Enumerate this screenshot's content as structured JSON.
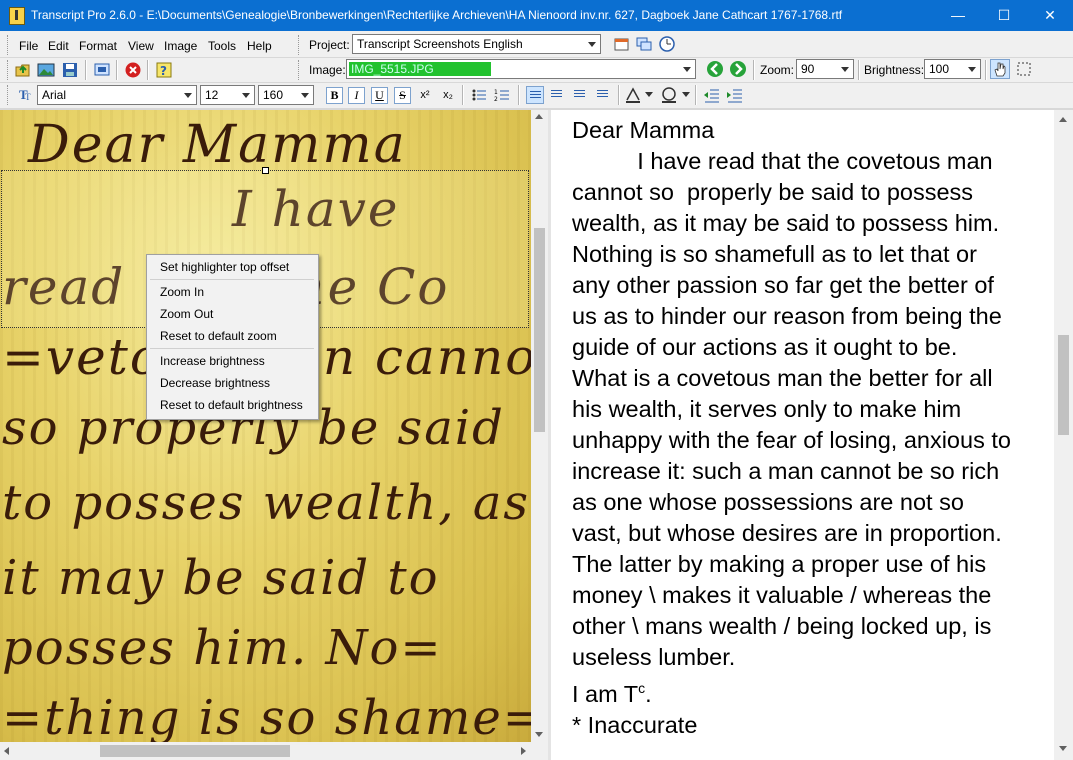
{
  "window": {
    "title": "Transcript Pro 2.6.0 - E:\\Documents\\Genealogie\\Bronbewerkingen\\Rechterlijke Archieven\\HA Nienoord inv.nr. 627, Dagboek Jane Cathcart 1767-1768.rtf",
    "minimize": "—",
    "maximize": "☐",
    "close": "✕"
  },
  "menu": [
    "File",
    "Edit",
    "Format",
    "View",
    "Image",
    "Tools",
    "Help"
  ],
  "project": {
    "label": "Project:",
    "value": "Transcript Screenshots English"
  },
  "image": {
    "label": "Image:",
    "value": "IMG_5515.JPG",
    "progress": 0.5
  },
  "zoom": {
    "label": "Zoom:",
    "value": "90"
  },
  "brightness": {
    "label": "Brightness:",
    "value": "100"
  },
  "font": {
    "name": "Arial",
    "size": "12",
    "second": "160"
  },
  "format_buttons": {
    "bold": "B",
    "italic": "I",
    "underline": "U",
    "strike": "S",
    "superscript": "x²",
    "subscript": "x₂"
  },
  "handwriting": [
    "Dear Mamma",
    "I have",
    "read that the Co",
    "=vetous man cannot",
    "so properly be said",
    "to posses wealth, as",
    "it may be said to",
    "posses him. No=",
    "=thing is so shame="
  ],
  "context_menu": [
    "Set highlighter top offset",
    "Zoom In",
    "Zoom Out",
    "Reset to default zoom",
    "Increase brightness",
    "Decrease brightness",
    "Reset to default brightness"
  ],
  "transcript": [
    "Dear Mamma",
    "          I have read that the covetous man",
    "cannot so  properly be said to possess",
    "wealth, as it may be said to possess him.",
    "Nothing is so shamefull as to let that or",
    "any other passion so far get the better of",
    "us as to hinder our reason from being the",
    "guide of our actions as it ought to be.",
    "What is a covetous man the better for all",
    "his wealth, it serves only to make him",
    "unhappy with the fear of losing, anxious to",
    "increase it: such a man cannot be so rich",
    "as one whose possessions are not so",
    "vast, but whose desires are in proportion.",
    "The latter by making a proper use of his",
    "money \\ makes it valuable / whereas the",
    "other \\ mans wealth / being locked up, is",
    "useless lumber.",
    "I am T",
    "* Inaccurate"
  ],
  "transcript_superscript": "c",
  "transcript_after_superscript": ".",
  "colors": {
    "titlebar": "#0b6fd1",
    "progress": "#22c22e",
    "paper": "#e8d36a",
    "ink": "#3a1c0a"
  }
}
